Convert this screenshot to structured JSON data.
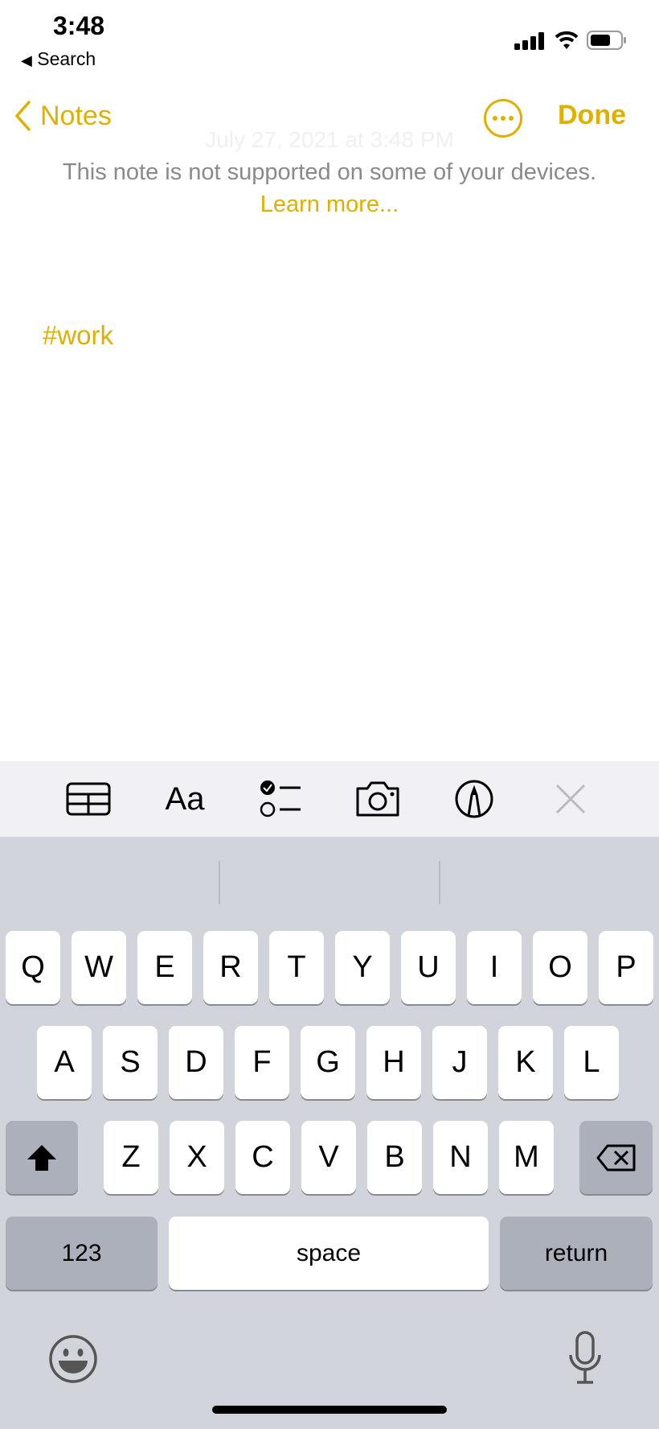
{
  "status_bar": {
    "time": "3:48",
    "back_app": "Search",
    "back_icon": "back-triangle-icon",
    "icons": [
      "cellular-signal-icon",
      "wifi-icon",
      "battery-icon"
    ]
  },
  "nav": {
    "back_label": "Notes",
    "done_label": "Done",
    "more_icon": "ellipsis-circle-icon"
  },
  "note": {
    "date": "July 27, 2021 at 3:48 PM",
    "notice_text": "This note is not supported on some of your devices.",
    "learn_more": "Learn more...",
    "tag": "#work"
  },
  "toolbar": {
    "icons": [
      "table-icon",
      "format-icon",
      "checklist-icon",
      "camera-icon",
      "markup-icon",
      "close-icon"
    ],
    "format_label": "Aa"
  },
  "keyboard": {
    "row1": [
      "Q",
      "W",
      "E",
      "R",
      "T",
      "Y",
      "U",
      "I",
      "O",
      "P"
    ],
    "row2": [
      "A",
      "S",
      "D",
      "F",
      "G",
      "H",
      "J",
      "K",
      "L"
    ],
    "row3": [
      "Z",
      "X",
      "C",
      "V",
      "B",
      "N",
      "M"
    ],
    "numbers_label": "123",
    "space_label": "space",
    "return_label": "return"
  },
  "colors": {
    "accent": "#e0b000",
    "keyboard_bg": "#d2d4dc",
    "toolbar_bg": "#f1f1f5"
  }
}
